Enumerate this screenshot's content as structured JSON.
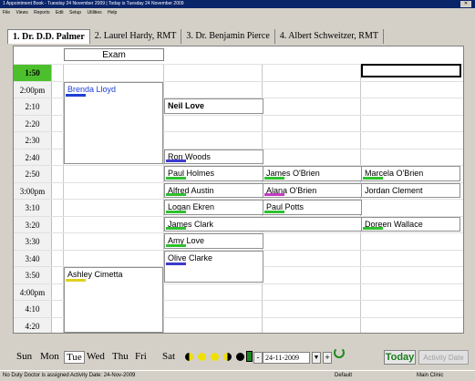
{
  "window": {
    "title": "1 Appointment Book - Tuesday 24 November 2009 | Today is Tuesday 24 November 2009"
  },
  "menu": [
    "File",
    "Views",
    "Reports",
    "Edit",
    "Setup",
    "Utilities",
    "Help"
  ],
  "tabs": [
    {
      "label": "1. Dr. D.D. Palmer",
      "active": true
    },
    {
      "label": "2. Laurel Hardy, RMT",
      "active": false
    },
    {
      "label": "3. Dr. Benjamin Pierce",
      "active": false
    },
    {
      "label": "4. Albert Schweitzer, RMT",
      "active": false
    }
  ],
  "grid": {
    "exam_label": "Exam",
    "times": [
      "1:50",
      "2:00pm",
      "2:10",
      "2:20",
      "2:30",
      "2:40",
      "2:50",
      "3:00pm",
      "3:10",
      "3:20",
      "3:30",
      "3:40",
      "3:50",
      "4:00pm",
      "4:10",
      "4:20"
    ],
    "current_time": "1:50",
    "appointments": [
      {
        "name": "Brenda Lloyd",
        "col": 0,
        "row": 1,
        "span": 5,
        "color": "#1d3fd6",
        "stripe": "#1d3fd6"
      },
      {
        "name": "Neil Love",
        "col": 1,
        "row": 2,
        "span": 1,
        "bold": true,
        "stripe": "#ffffff"
      },
      {
        "name": "Ron Woods",
        "col": 1,
        "row": 5,
        "span": 1,
        "stripe": "#3c3ccc"
      },
      {
        "name": "Paul Holmes",
        "col": 1,
        "row": 6,
        "span": 1,
        "stripe": "#2ec12e"
      },
      {
        "name": "James O'Brien",
        "col": 2,
        "row": 6,
        "span": 1,
        "stripe": "#2ec12e"
      },
      {
        "name": "Marcela O'Brien",
        "col": 3,
        "row": 6,
        "span": 1,
        "stripe": "#2ec12e"
      },
      {
        "name": "Alfred Austin",
        "col": 1,
        "row": 7,
        "span": 1,
        "stripe": "#2ec12e"
      },
      {
        "name": "Alana O'Brien",
        "col": 2,
        "row": 7,
        "span": 1,
        "stripe": "#c23cc2"
      },
      {
        "name": "Jordan Clement",
        "col": 3,
        "row": 7,
        "span": 1,
        "stripe": "#ffffff"
      },
      {
        "name": "Logan Ekren",
        "col": 1,
        "row": 8,
        "span": 1,
        "stripe": "#2ec12e"
      },
      {
        "name": "Paul Potts",
        "col": 2,
        "row": 8,
        "span": 1,
        "stripe": "#2ec12e"
      },
      {
        "name": "James Clark",
        "col": 1,
        "row": 9,
        "span": 1,
        "wide": true,
        "stripe": "#2ec12e"
      },
      {
        "name": "Doreen Wallace",
        "col": 3,
        "row": 9,
        "span": 1,
        "stripe": "#2ec12e"
      },
      {
        "name": "Amy Love",
        "col": 1,
        "row": 10,
        "span": 1,
        "stripe": "#2ec12e"
      },
      {
        "name": "Olive Clarke",
        "col": 1,
        "row": 11,
        "span": 2,
        "stripe": "#3c3ccc"
      },
      {
        "name": "Ashley Cimetta",
        "col": 0,
        "row": 12,
        "span": 4,
        "stripe": "#e0d020"
      }
    ]
  },
  "bottom": {
    "days": [
      "Sun",
      "Mon",
      "Tue",
      "Wed",
      "Thu",
      "Fri",
      "Sat"
    ],
    "active_day": "Tue",
    "date": "24-11-2009",
    "prev": "-",
    "next": "+",
    "today": "Today",
    "activity": "Activity Date"
  },
  "status": {
    "message": "No Duty Doctor is assigned  Activity Date: 24-Nov-2009",
    "mode": "Default",
    "clinic": "Main Clinic"
  },
  "colors": {
    "current_slot": "#4cbf2c",
    "title_bar": "#0a246a",
    "today_text": "#1a7b1a"
  }
}
